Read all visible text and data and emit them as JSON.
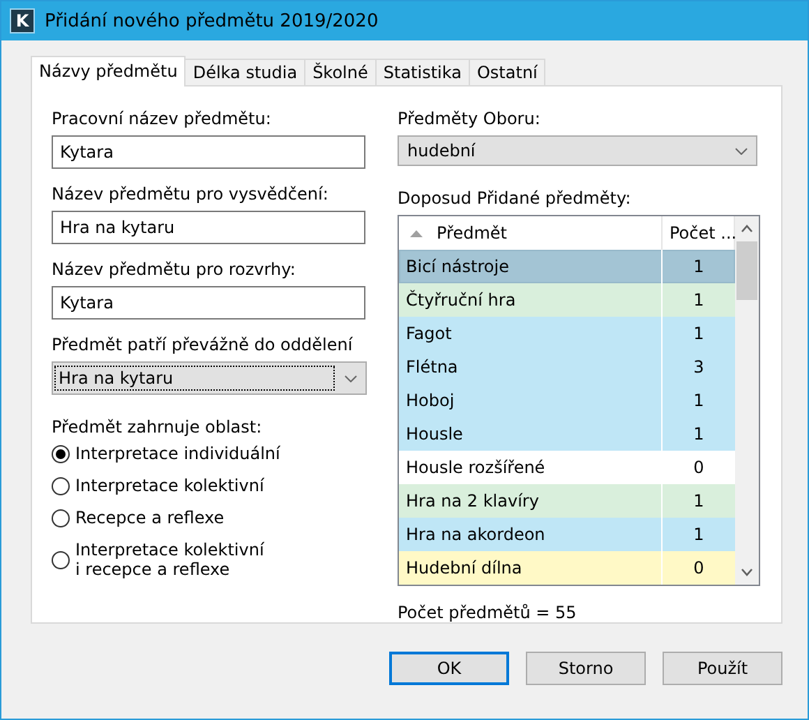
{
  "window": {
    "title": "Přidání nového předmětu 2019/2020",
    "app_icon": "K"
  },
  "tabs": [
    {
      "label": "Názvy předmětu",
      "selected": true
    },
    {
      "label": "Délka studia",
      "selected": false
    },
    {
      "label": "Školné",
      "selected": false
    },
    {
      "label": "Statistika",
      "selected": false
    },
    {
      "label": "Ostatní",
      "selected": false
    }
  ],
  "left": {
    "fields": [
      {
        "label": "Pracovní název předmětu:",
        "value": "Kytara"
      },
      {
        "label": "Název předmětu pro vysvědčení:",
        "value": "Hra na kytaru"
      },
      {
        "label": "Název předmětu pro rozvrhy:",
        "value": "Kytara"
      }
    ],
    "department": {
      "label": "Předmět patří převážně do oddělení",
      "value": "Hra na kytaru",
      "focused": true
    },
    "area": {
      "label": "Předmět zahrnuje oblast:",
      "options": [
        {
          "label": "Interpretace individuální",
          "selected": true
        },
        {
          "label": "Interpretace kolektivní",
          "selected": false
        },
        {
          "label": "Recepce a reflexe",
          "selected": false
        },
        {
          "label": "Interpretace kolektivní\ni recepce a reflexe",
          "selected": false
        }
      ]
    }
  },
  "right": {
    "field_select": {
      "label": "Předměty Oboru:",
      "value": "hudební",
      "focused": false
    },
    "table": {
      "label": "Doposud Přidané předměty:",
      "columns": [
        "Předmět",
        "Počet ..."
      ],
      "rows": [
        {
          "cells": [
            "Bicí nástroje",
            "1"
          ],
          "selected": true,
          "color": "#a3c4d4"
        },
        {
          "cells": [
            "Čtyřruční hra",
            "1"
          ],
          "selected": false,
          "color": "#d9efdc"
        },
        {
          "cells": [
            "Fagot",
            "1"
          ],
          "selected": false,
          "color": "#bfe6f6"
        },
        {
          "cells": [
            "Flétna",
            "3"
          ],
          "selected": false,
          "color": "#bfe6f6"
        },
        {
          "cells": [
            "Hoboj",
            "1"
          ],
          "selected": false,
          "color": "#bfe6f6"
        },
        {
          "cells": [
            "Housle",
            "1"
          ],
          "selected": false,
          "color": "#bfe6f6"
        },
        {
          "cells": [
            "Housle rozšířené",
            "0"
          ],
          "selected": false,
          "color": "#ffffff"
        },
        {
          "cells": [
            "Hra na 2 klavíry",
            "1"
          ],
          "selected": false,
          "color": "#d9efdc"
        },
        {
          "cells": [
            "Hra na akordeon",
            "1"
          ],
          "selected": false,
          "color": "#bfe6f6"
        },
        {
          "cells": [
            "Hudební dílna",
            "0"
          ],
          "selected": false,
          "color": "#fff9c6"
        }
      ]
    },
    "count": "Počet předmětů = 55"
  },
  "buttons": [
    {
      "label": "OK",
      "default": true
    },
    {
      "label": "Storno",
      "default": false
    },
    {
      "label": "Použít",
      "default": false
    }
  ]
}
